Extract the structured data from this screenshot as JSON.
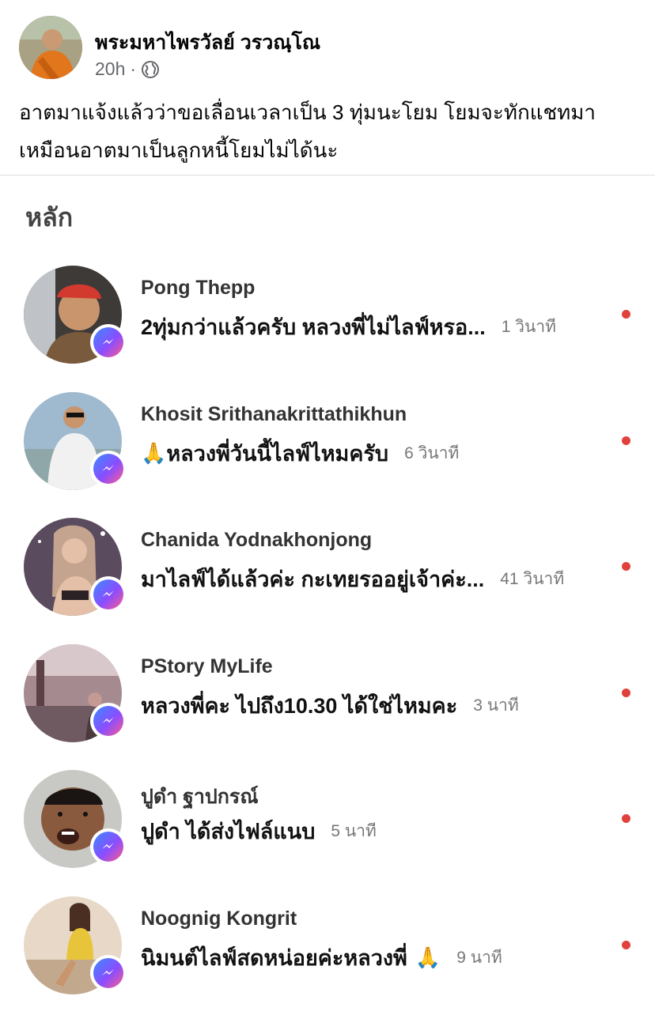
{
  "post": {
    "author": "พระมหาไพรวัลย์ วรวณฺโณ",
    "time": "20h",
    "separator": "·",
    "audience_icon": "globe-icon",
    "text": "อาตมาแจ้งแล้วว่าขอเลื่อนเวลาเป็น 3 ทุ่มนะโยม โยมจะทักแชทมา เหมือนอาตมาเป็นลูกหนี้โยมไม่ได้นะ"
  },
  "chats": {
    "section_title": "หลัก",
    "items": [
      {
        "name": "Pong Thepp",
        "message": "2ทุ่มกว่าแล้วครับ หลวงพี่ไม่ไลฟ์หรอ...",
        "time": "1 วินาที",
        "unread": true,
        "avatar_color": "#3d3a38"
      },
      {
        "name": "Khosit Srithanakrittathikhun",
        "prefix_emoji": "🙏",
        "message": "หลวงพี่วันนี้ไลฟ์ไหมครับ",
        "time": "6 วินาที",
        "unread": true,
        "avatar_color": "#9fb9cf"
      },
      {
        "name": "Chanida Yodnakhonjong",
        "message": "มาไลฟ์ได้แล้วค่ะ กะเทยรออยู่เจ้าค่ะ...",
        "time": "41 วินาที",
        "unread": true,
        "avatar_color": "#5a4b5e"
      },
      {
        "name": "PStory MyLife",
        "message": "หลวงพี่คะ ไปถึง10.30 ได้ใช่ไหมคะ",
        "time": "3 นาที",
        "unread": true,
        "avatar_color": "#a58a8f"
      },
      {
        "name": "ปูดำ ฐาปกรณ์",
        "message": "ปูดำ ได้ส่งไฟล์แนบ",
        "time": "5 นาที",
        "unread": true,
        "avatar_color": "#c8c9c4"
      },
      {
        "name": "Noognig Kongrit",
        "message": "นิมนต์ไลฟ์สดหน่อยค่ะหลวงพี่",
        "suffix_emoji": "🙏",
        "time": "9 นาที",
        "unread": true,
        "avatar_color": "#e7d8c7"
      }
    ]
  },
  "colors": {
    "unread_dot": "#e0413a",
    "badge_gradient_start": "#3a8bff",
    "badge_gradient_end": "#ff5b8c"
  }
}
